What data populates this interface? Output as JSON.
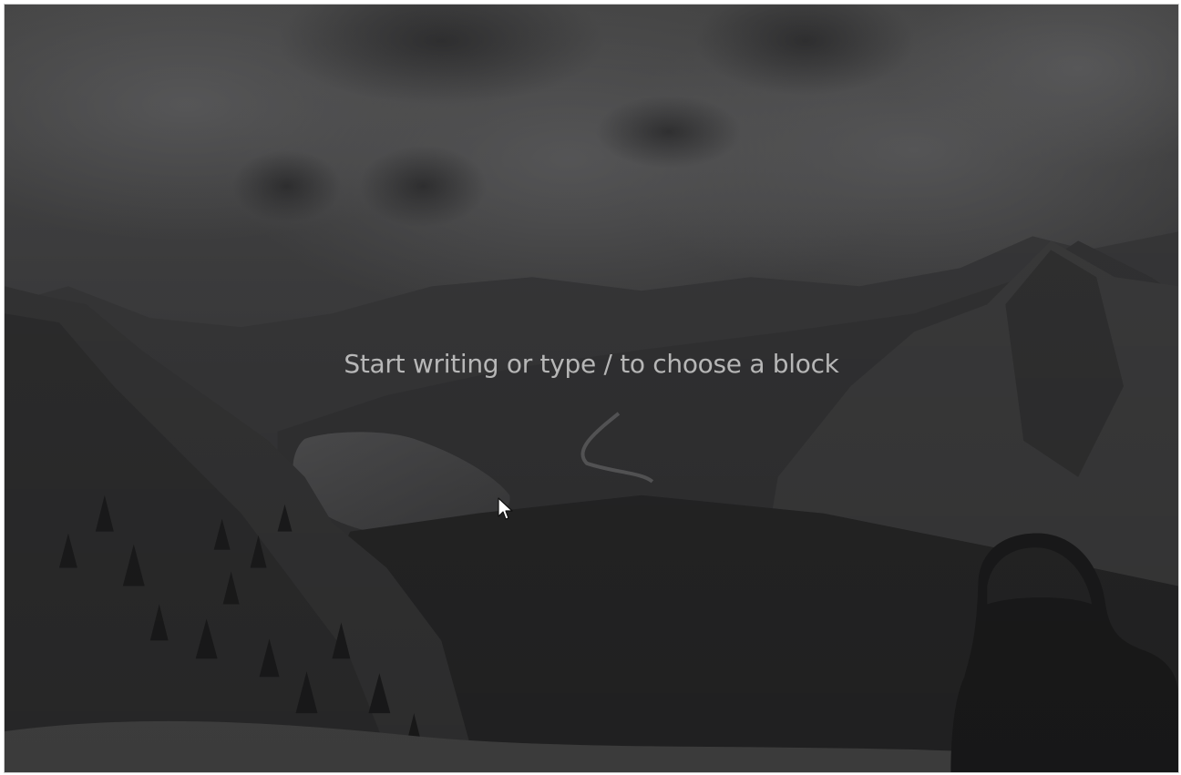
{
  "editor": {
    "cover_placeholder": "Start writing or type / to choose a block",
    "cover_image": "mountain-lake-valley-photo",
    "overlay_color": "#000000",
    "overlay_opacity": 0.5
  },
  "pointer": {
    "icon": "mouse-pointer-icon"
  }
}
